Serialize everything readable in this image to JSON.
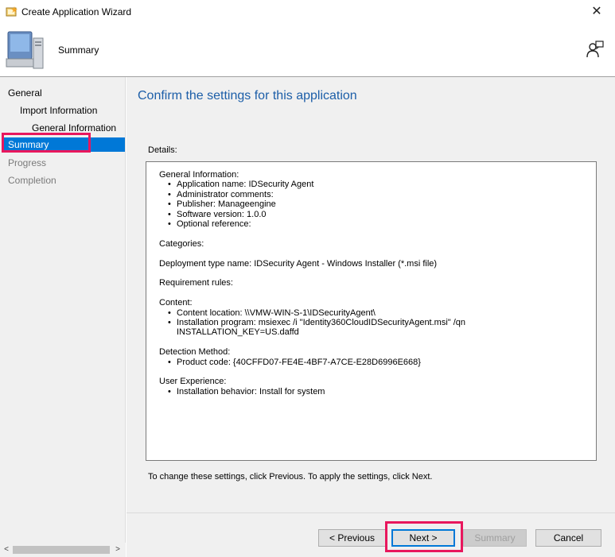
{
  "window": {
    "title": "Create Application Wizard",
    "close_glyph": "✕"
  },
  "header": {
    "title": "Summary",
    "icons": [
      "computer-icon",
      "help-icon"
    ]
  },
  "nav": {
    "items": [
      {
        "label": "General",
        "state": "normal"
      },
      {
        "label": "Import Information",
        "state": "normal"
      },
      {
        "label": "General Information",
        "state": "normal"
      },
      {
        "label": "Summary",
        "state": "selected"
      },
      {
        "label": "Progress",
        "state": "disabled"
      },
      {
        "label": "Completion",
        "state": "disabled"
      }
    ],
    "scroll_left": "<",
    "scroll_right": ">"
  },
  "main": {
    "heading": "Confirm the settings for this application",
    "details_label": "Details:",
    "details": {
      "general_heading": "General Information:",
      "general_items": [
        "Application name: IDSecurity Agent",
        "Administrator comments:",
        "Publisher: Manageengine",
        "Software version: 1.0.0",
        "Optional reference:"
      ],
      "categories": "Categories:",
      "deployment_type": "Deployment type name: IDSecurity Agent - Windows Installer (*.msi file)",
      "requirement_rules": "Requirement rules:",
      "content_heading": "Content:",
      "content_items": [
        "Content location: \\\\VMW-WIN-S-1\\IDSecurityAgent\\",
        "Installation program: msiexec /i \"Identity360CloudIDSecurityAgent.msi\" /qn",
        "INSTALLATION_KEY=US.daffd"
      ],
      "detection_heading": "Detection Method:",
      "detection_items": [
        "Product code: {40CFFD07-FE4E-4BF7-A7CE-E28D6996E668}"
      ],
      "ux_heading": "User Experience:",
      "ux_items": [
        "Installation behavior: Install for system"
      ]
    },
    "hint": "To change these settings, click Previous. To apply the settings, click Next."
  },
  "buttons": {
    "previous": "< Previous",
    "next": "Next >",
    "summary": "Summary",
    "cancel": "Cancel"
  },
  "colors": {
    "accent": "#0078d7",
    "heading": "#1c5ea8",
    "annotation": "#e8175d"
  }
}
